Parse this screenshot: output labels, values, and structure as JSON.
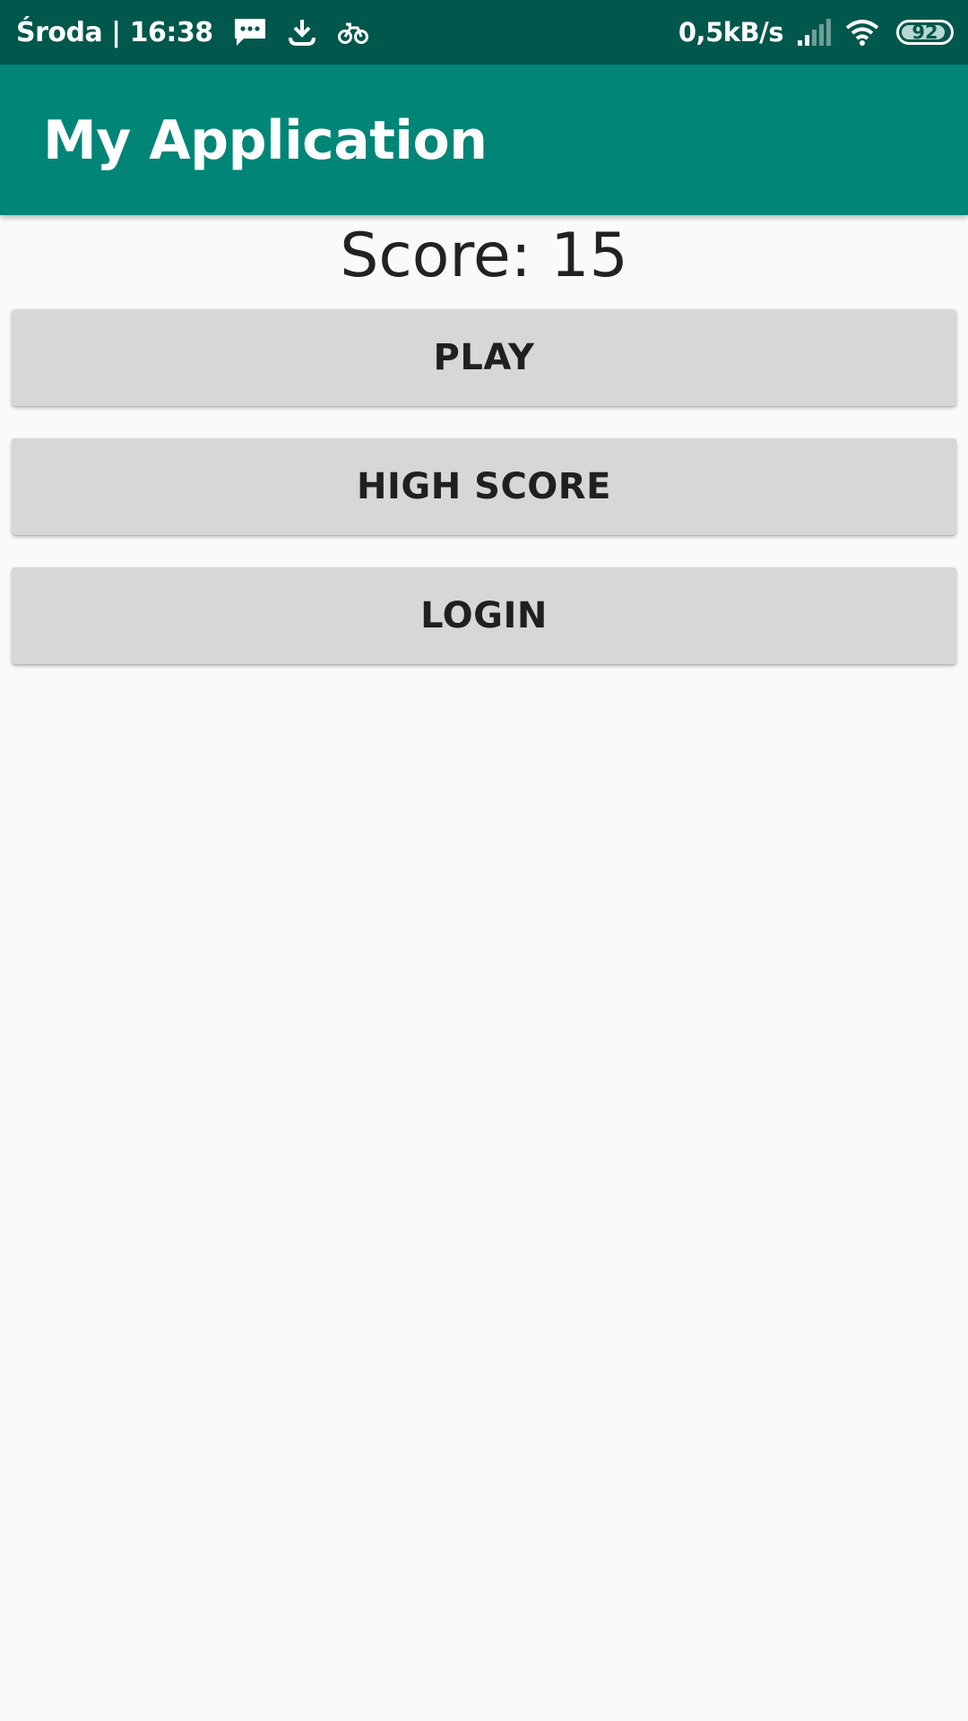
{
  "status_bar": {
    "day_time": "Środa | 16:38",
    "net_speed": "0,5kB/s",
    "battery_level": "92",
    "icons": [
      "message-icon",
      "download-icon",
      "bike-icon",
      "signal-icon",
      "wifi-icon",
      "battery-icon"
    ],
    "battery_fraction": 0.92
  },
  "app_bar": {
    "title": "My Application"
  },
  "main": {
    "score": "Score: 15",
    "buttons": {
      "play": "PLAY",
      "high_score": "HIGH SCORE",
      "login": "LOGIN"
    }
  },
  "colors": {
    "status_bar": "#00574b",
    "app_bar": "#008577",
    "background": "#fafafa",
    "button": "#d6d7d7"
  }
}
